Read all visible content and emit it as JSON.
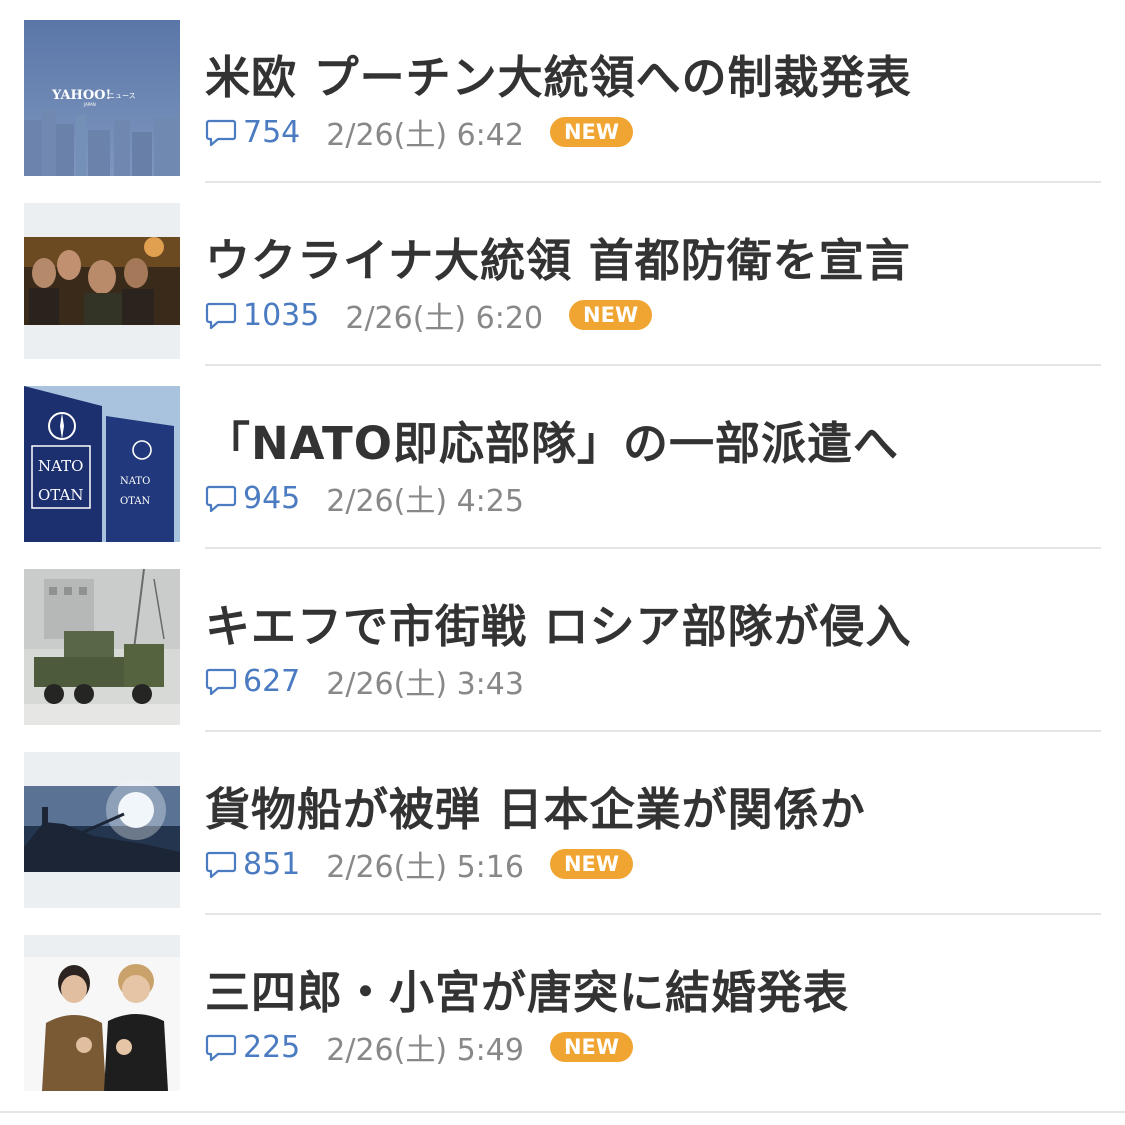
{
  "items": [
    {
      "headline": "米欧 プーチン大統領への制裁発表",
      "comments": "754",
      "timestamp": "2/26(土) 6:42",
      "badge": "NEW",
      "thumbnail_logo": "YAHOO! JAPAN ニュース"
    },
    {
      "headline": "ウクライナ大統領 首都防衛を宣言",
      "comments": "1035",
      "timestamp": "2/26(土) 6:20",
      "badge": "NEW"
    },
    {
      "headline": "「NATO即応部隊」の一部派遣へ",
      "comments": "945",
      "timestamp": "2/26(土) 4:25",
      "badge": ""
    },
    {
      "headline": "キエフで市街戦 ロシア部隊が侵入",
      "comments": "627",
      "timestamp": "2/26(土) 3:43",
      "badge": ""
    },
    {
      "headline": "貨物船が被弾 日本企業が関係か",
      "comments": "851",
      "timestamp": "2/26(土) 5:16",
      "badge": "NEW"
    },
    {
      "headline": "三四郎・小宮が唐突に結婚発表",
      "comments": "225",
      "timestamp": "2/26(土) 5:49",
      "badge": "NEW"
    }
  ],
  "colors": {
    "headline": "#333333",
    "comment_count": "#4b7bc0",
    "timestamp": "#888888",
    "badge_bg": "#f0a431",
    "divider": "#e5e5e5"
  },
  "icons": {
    "comment": "speech-bubble-icon"
  }
}
